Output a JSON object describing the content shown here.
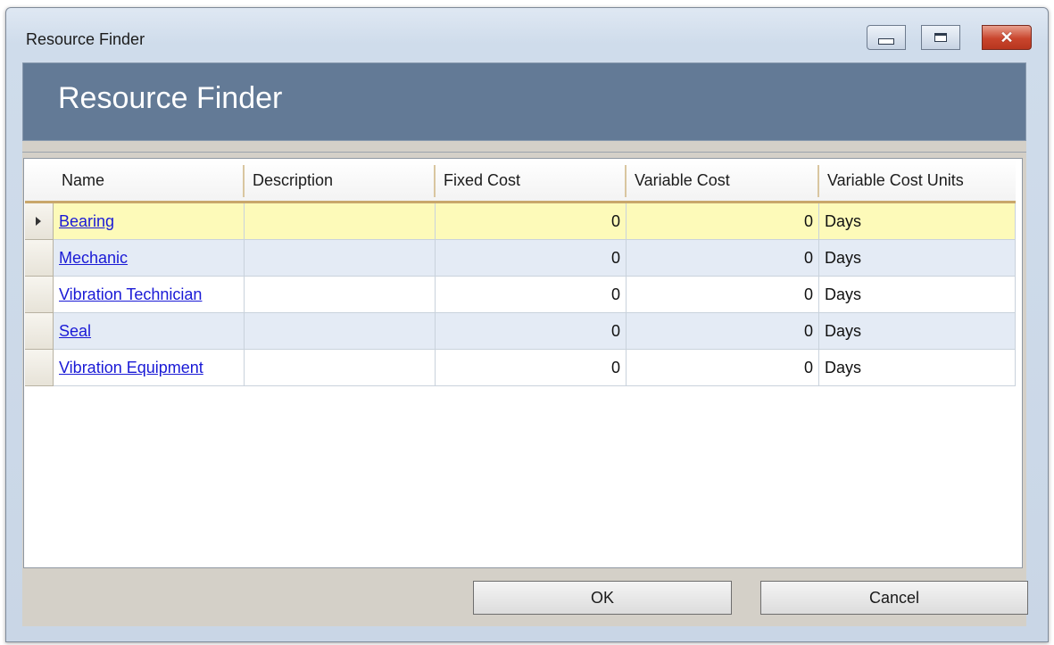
{
  "window": {
    "title": "Resource Finder",
    "controls": {
      "minimize": "minimize",
      "maximize": "maximize",
      "close": "close"
    }
  },
  "banner": {
    "title": "Resource Finder"
  },
  "table": {
    "columns": [
      "Name",
      "Description",
      "Fixed Cost",
      "Variable Cost",
      "Variable Cost Units"
    ],
    "rows": [
      {
        "name": "Bearing",
        "description": "",
        "fixed_cost": "0",
        "variable_cost": "0",
        "units": "Days"
      },
      {
        "name": "Mechanic",
        "description": "",
        "fixed_cost": "0",
        "variable_cost": "0",
        "units": "Days"
      },
      {
        "name": "Vibration Technician",
        "description": "",
        "fixed_cost": "0",
        "variable_cost": "0",
        "units": "Days"
      },
      {
        "name": "Seal",
        "description": "",
        "fixed_cost": "0",
        "variable_cost": "0",
        "units": "Days"
      },
      {
        "name": "Vibration Equipment",
        "description": "",
        "fixed_cost": "0",
        "variable_cost": "0",
        "units": "Days"
      }
    ],
    "selected_row": 0
  },
  "buttons": {
    "ok": "OK",
    "cancel": "Cancel"
  },
  "colors": {
    "banner": "#637a96",
    "selected_row": "#fdfab9",
    "alt_row": "#e4ebf5",
    "link": "#1a1ad6",
    "close_button": "#c9452d"
  },
  "icons": {
    "row_indicator": "triangle-right-icon"
  }
}
